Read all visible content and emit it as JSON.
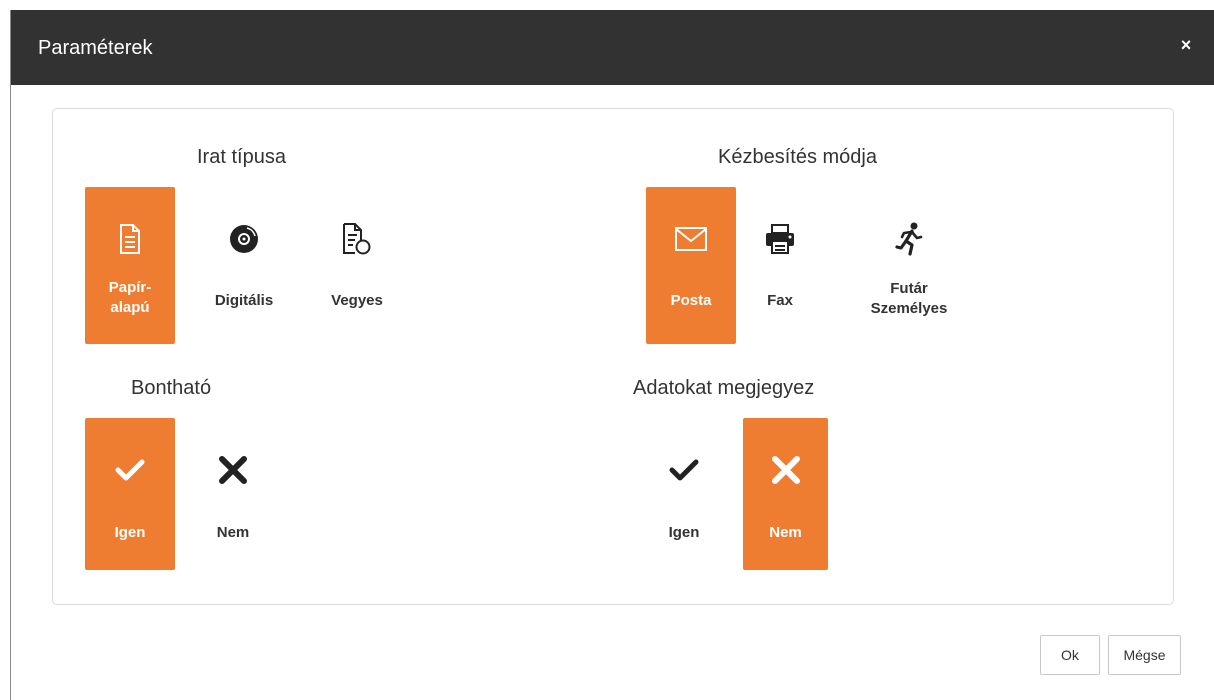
{
  "dialog": {
    "title": "Paraméterek",
    "close_label": "×"
  },
  "sections": {
    "irat_tipusa": {
      "label": "Irat típusa",
      "options": [
        {
          "label": "Papír-\nalapú",
          "icon": "document-icon",
          "selected": true
        },
        {
          "label": "Digitális",
          "icon": "disc-icon",
          "selected": false
        },
        {
          "label": "Vegyes",
          "icon": "mixed-document-icon",
          "selected": false
        }
      ]
    },
    "kezbesites_modja": {
      "label": "Kézbesítés módja",
      "options": [
        {
          "label": "Posta",
          "icon": "envelope-icon",
          "selected": true
        },
        {
          "label": "Fax",
          "icon": "printer-icon",
          "selected": false
        },
        {
          "label": "Futár\nSzemélyes",
          "icon": "runner-icon",
          "selected": false
        }
      ]
    },
    "bonthato": {
      "label": "Bontható",
      "options": [
        {
          "label": "Igen",
          "icon": "check-icon",
          "selected": true
        },
        {
          "label": "Nem",
          "icon": "x-icon",
          "selected": false
        }
      ]
    },
    "adatokat_megjegyez": {
      "label": "Adatokat megjegyez",
      "options": [
        {
          "label": "Igen",
          "icon": "check-icon",
          "selected": false
        },
        {
          "label": "Nem",
          "icon": "x-icon",
          "selected": true
        }
      ]
    }
  },
  "footer": {
    "ok_label": "Ok",
    "cancel_label": "Mégse"
  },
  "colors": {
    "accent": "#ee7d31",
    "titlebar": "#323232"
  }
}
